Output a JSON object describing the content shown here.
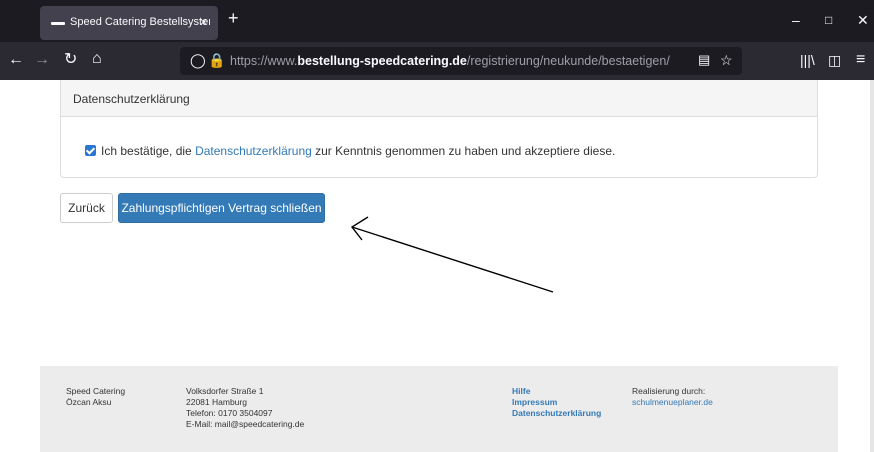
{
  "browser": {
    "tab_title": "Speed Catering Bestellsystem -",
    "tab_close": "×",
    "new_tab": "+",
    "url_prefix": "https://www.",
    "url_host": "bestellung-speedcatering.de",
    "url_path": "/registrierung/neukunde/bestaetigen/",
    "icons": [
      "back-icon",
      "forward-icon",
      "reload-icon",
      "home-icon",
      "shield-icon",
      "lock-icon",
      "reader-icon",
      "bookmark-star-icon",
      "library-icon",
      "sidebar-icon",
      "menu-icon"
    ]
  },
  "panel": {
    "heading": "Datenschutzerklärung",
    "check_text_before": "Ich bestätige, die ",
    "check_link": "Datenschutzerklärung",
    "check_text_after": " zur Kenntnis genommen zu haben und akzeptiere diese.",
    "checked": true
  },
  "buttons": {
    "back": "Zurück",
    "submit": "Zahlungspflichtigen Vertrag schließen"
  },
  "footer": {
    "company": [
      "Speed Catering",
      "Özcan Aksu"
    ],
    "address": [
      "Volksdorfer Straße 1",
      "22081 Hamburg",
      "Telefon: 0170 3504097",
      "E-Mail: mail@speedcatering.de"
    ],
    "links": [
      "Hilfe",
      "Impressum",
      "Datenschutzerklärung"
    ],
    "credit_label": "Realisierung durch:",
    "credit_link": "schulmenueplaner.de"
  },
  "colors": {
    "accent": "#337ab7",
    "checkbox": "#2a76d2",
    "browser_dark": "#1c1b22"
  }
}
